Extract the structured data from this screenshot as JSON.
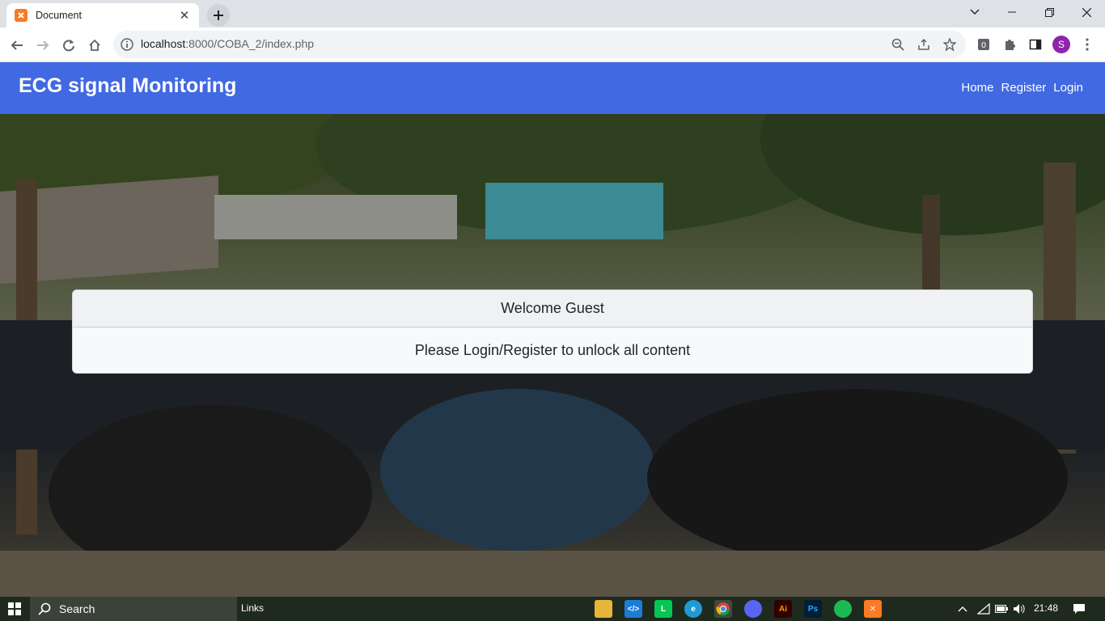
{
  "browser": {
    "tab_title": "Document",
    "url_host": "localhost",
    "url_rest": ":8000/COBA_2/index.php"
  },
  "profile_initial": "S",
  "site": {
    "brand": "ECG signal Monitoring",
    "nav": [
      "Home",
      "Register",
      "Login"
    ]
  },
  "card": {
    "header": "Welcome Guest",
    "body": "Please Login/Register to unlock all content"
  },
  "taskbar": {
    "search_label": "Search",
    "links_label": "Links",
    "time": "21:48",
    "apps": [
      "file-explorer",
      "vscode",
      "line",
      "edge",
      "chrome",
      "discord",
      "illustrator",
      "photoshop",
      "spotify",
      "xampp"
    ]
  },
  "colors": {
    "navbar": "#4169e1",
    "card_bg": "#f8f9fa"
  }
}
